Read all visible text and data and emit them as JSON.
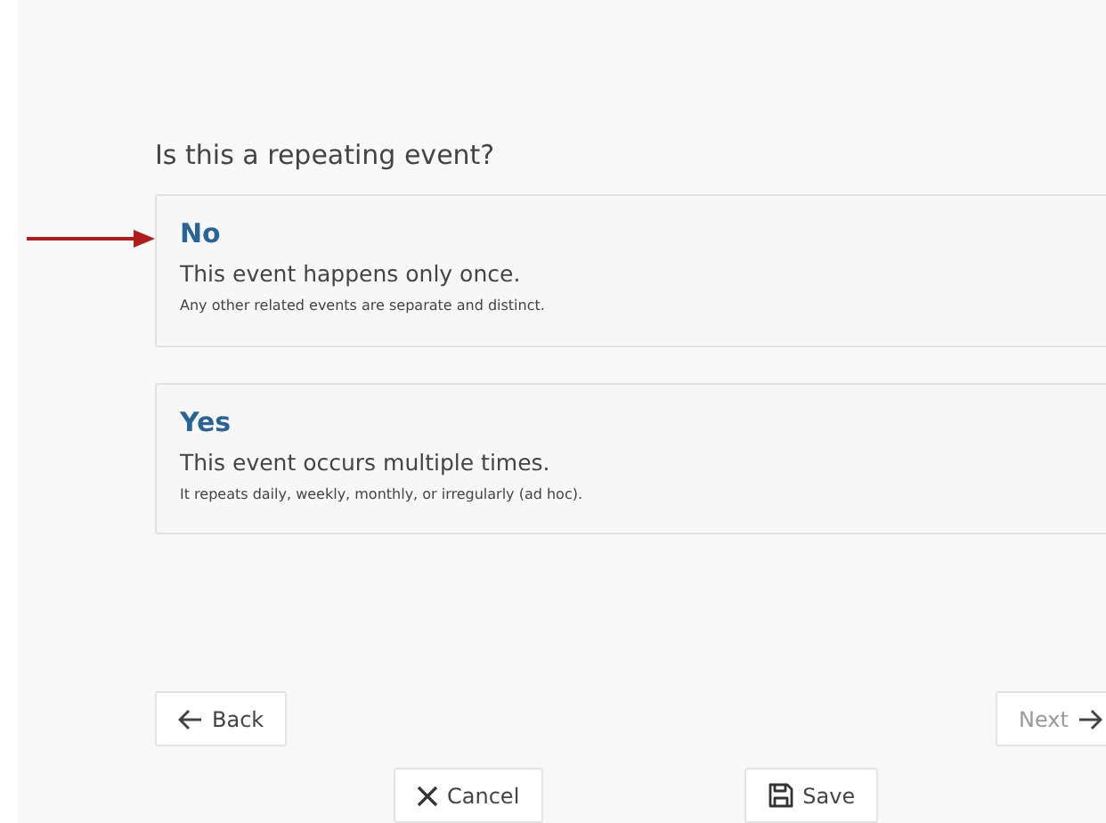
{
  "question": "Is this a repeating event?",
  "options": [
    {
      "title": "No",
      "description": "This event happens only once.",
      "note": "Any other related events are separate and distinct."
    },
    {
      "title": "Yes",
      "description": "This event occurs multiple times.",
      "note": "It repeats daily, weekly, monthly, or irregularly (ad hoc)."
    }
  ],
  "navigation": {
    "back": {
      "label": "Back",
      "disabled": false
    },
    "next": {
      "label": "Next",
      "disabled": true
    }
  },
  "actions": {
    "cancel": "Cancel",
    "save": "Save"
  }
}
